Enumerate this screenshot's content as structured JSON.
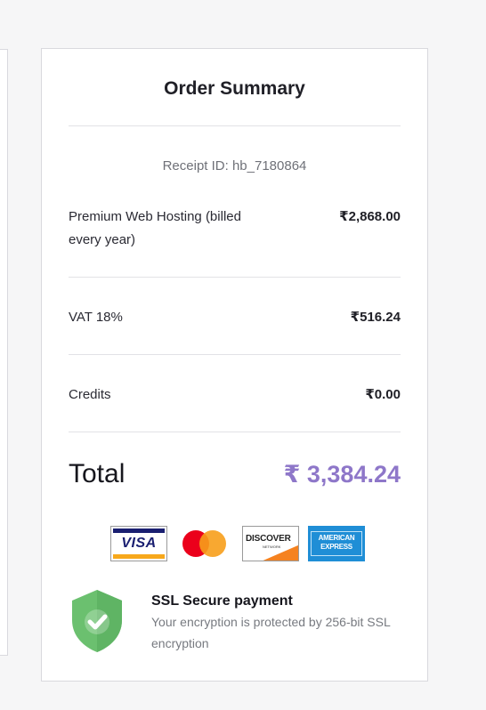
{
  "summary": {
    "title": "Order Summary",
    "receipt_id": "Receipt ID: hb_7180864",
    "items": [
      {
        "label": "Premium Web Hosting (billed every year)",
        "amount": "₹2,868.00"
      },
      {
        "label": "VAT 18%",
        "amount": "₹516.24"
      },
      {
        "label": "Credits",
        "amount": "₹0.00"
      }
    ],
    "total_label": "Total",
    "total_amount": "₹ 3,384.24",
    "accent_color": "#8e77c9"
  },
  "payment_cards": {
    "visa": "VISA",
    "mastercard": "mastercard-logo",
    "discover": "DISCOVER",
    "discover_sub": "NETWORK",
    "amex_line1": "AMERICAN",
    "amex_line2": "EXPRESS"
  },
  "security": {
    "icon": "shield-check-icon",
    "title": "SSL Secure payment",
    "description": "Your encryption is protected by 256-bit SSL encryption",
    "shield_color": "#6bc06f"
  }
}
